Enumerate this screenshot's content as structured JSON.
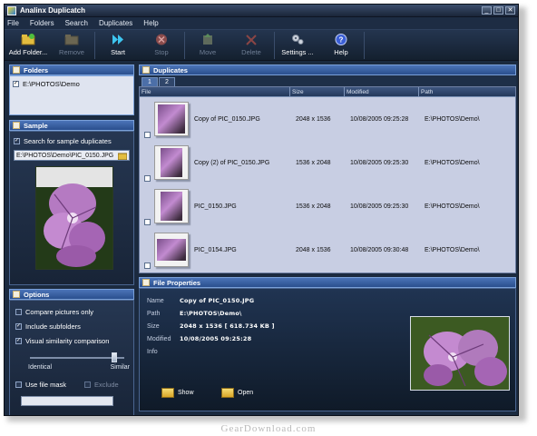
{
  "window": {
    "title": "Analinx Duplicatch",
    "controls": [
      "_",
      "□",
      "✕"
    ]
  },
  "menu": [
    "File",
    "Folders",
    "Search",
    "Duplicates",
    "Help"
  ],
  "toolbar": [
    {
      "label": "Add Folder...",
      "icon": "add-folder-icon",
      "enabled": true
    },
    {
      "label": "Remove",
      "icon": "remove-folder-icon",
      "enabled": false
    },
    {
      "label": "Start",
      "icon": "start-icon",
      "enabled": true
    },
    {
      "label": "Stop",
      "icon": "stop-icon",
      "enabled": false
    },
    {
      "label": "Move",
      "icon": "move-icon",
      "enabled": false
    },
    {
      "label": "Delete",
      "icon": "delete-icon",
      "enabled": false
    },
    {
      "label": "Settings ...",
      "icon": "settings-icon",
      "enabled": true
    },
    {
      "label": "Help",
      "icon": "help-icon",
      "enabled": true
    }
  ],
  "folders": {
    "title": "Folders",
    "items": [
      {
        "path": "E:\\PHOTOS\\Demo",
        "checked": true
      }
    ]
  },
  "sample": {
    "title": "Sample",
    "search_label": "Search for sample duplicates",
    "search_checked": true,
    "path": "E:\\PHOTOS\\Demo\\PIC_0150.JPG"
  },
  "options": {
    "title": "Options",
    "compare_label": "Compare pictures only",
    "compare_checked": false,
    "subfolders_label": "Include subfolders",
    "subfolders_checked": true,
    "visual_label": "Visual similarity comparison",
    "visual_checked": true,
    "similarity_level": 0.92,
    "slider_left": "Identical",
    "slider_right": "Similar",
    "file_mask_label": "Use file mask",
    "exclude_label": "Exclude"
  },
  "duplicates": {
    "title": "Duplicates",
    "tabs": [
      "1",
      "2"
    ],
    "columns": [
      "File",
      "Size",
      "Modified",
      "Path"
    ],
    "rows": [
      {
        "file": "Copy of PIC_0150.JPG",
        "size": "2048 x 1536",
        "modified": "10/08/2005 09:25:28",
        "path": "E:\\PHOTOS\\Demo\\"
      },
      {
        "file": "Copy (2) of PIC_0150.JPG",
        "size": "1536 x 2048",
        "modified": "10/08/2005 09:25:30",
        "path": "E:\\PHOTOS\\Demo\\"
      },
      {
        "file": "PIC_0150.JPG",
        "size": "1536 x 2048",
        "modified": "10/08/2005 09:25:30",
        "path": "E:\\PHOTOS\\Demo\\"
      },
      {
        "file": "PIC_0154.JPG",
        "size": "2048 x 1536",
        "modified": "10/08/2005 09:30:48",
        "path": "E:\\PHOTOS\\Demo\\"
      }
    ]
  },
  "properties": {
    "title": "File Properties",
    "name_label": "Name",
    "name": "Copy of PIC_0150.JPG",
    "path_label": "Path",
    "path": "E:\\PHOTOS\\Demo\\",
    "size_label": "Size",
    "size": "2048 x 1536  [ 618.734 KB ]",
    "modified_label": "Modified",
    "modified": "10/08/2005 09:25:28",
    "info_label": "Info",
    "show_label": "Show",
    "open_label": "Open"
  },
  "watermark": "GearDownload.com"
}
